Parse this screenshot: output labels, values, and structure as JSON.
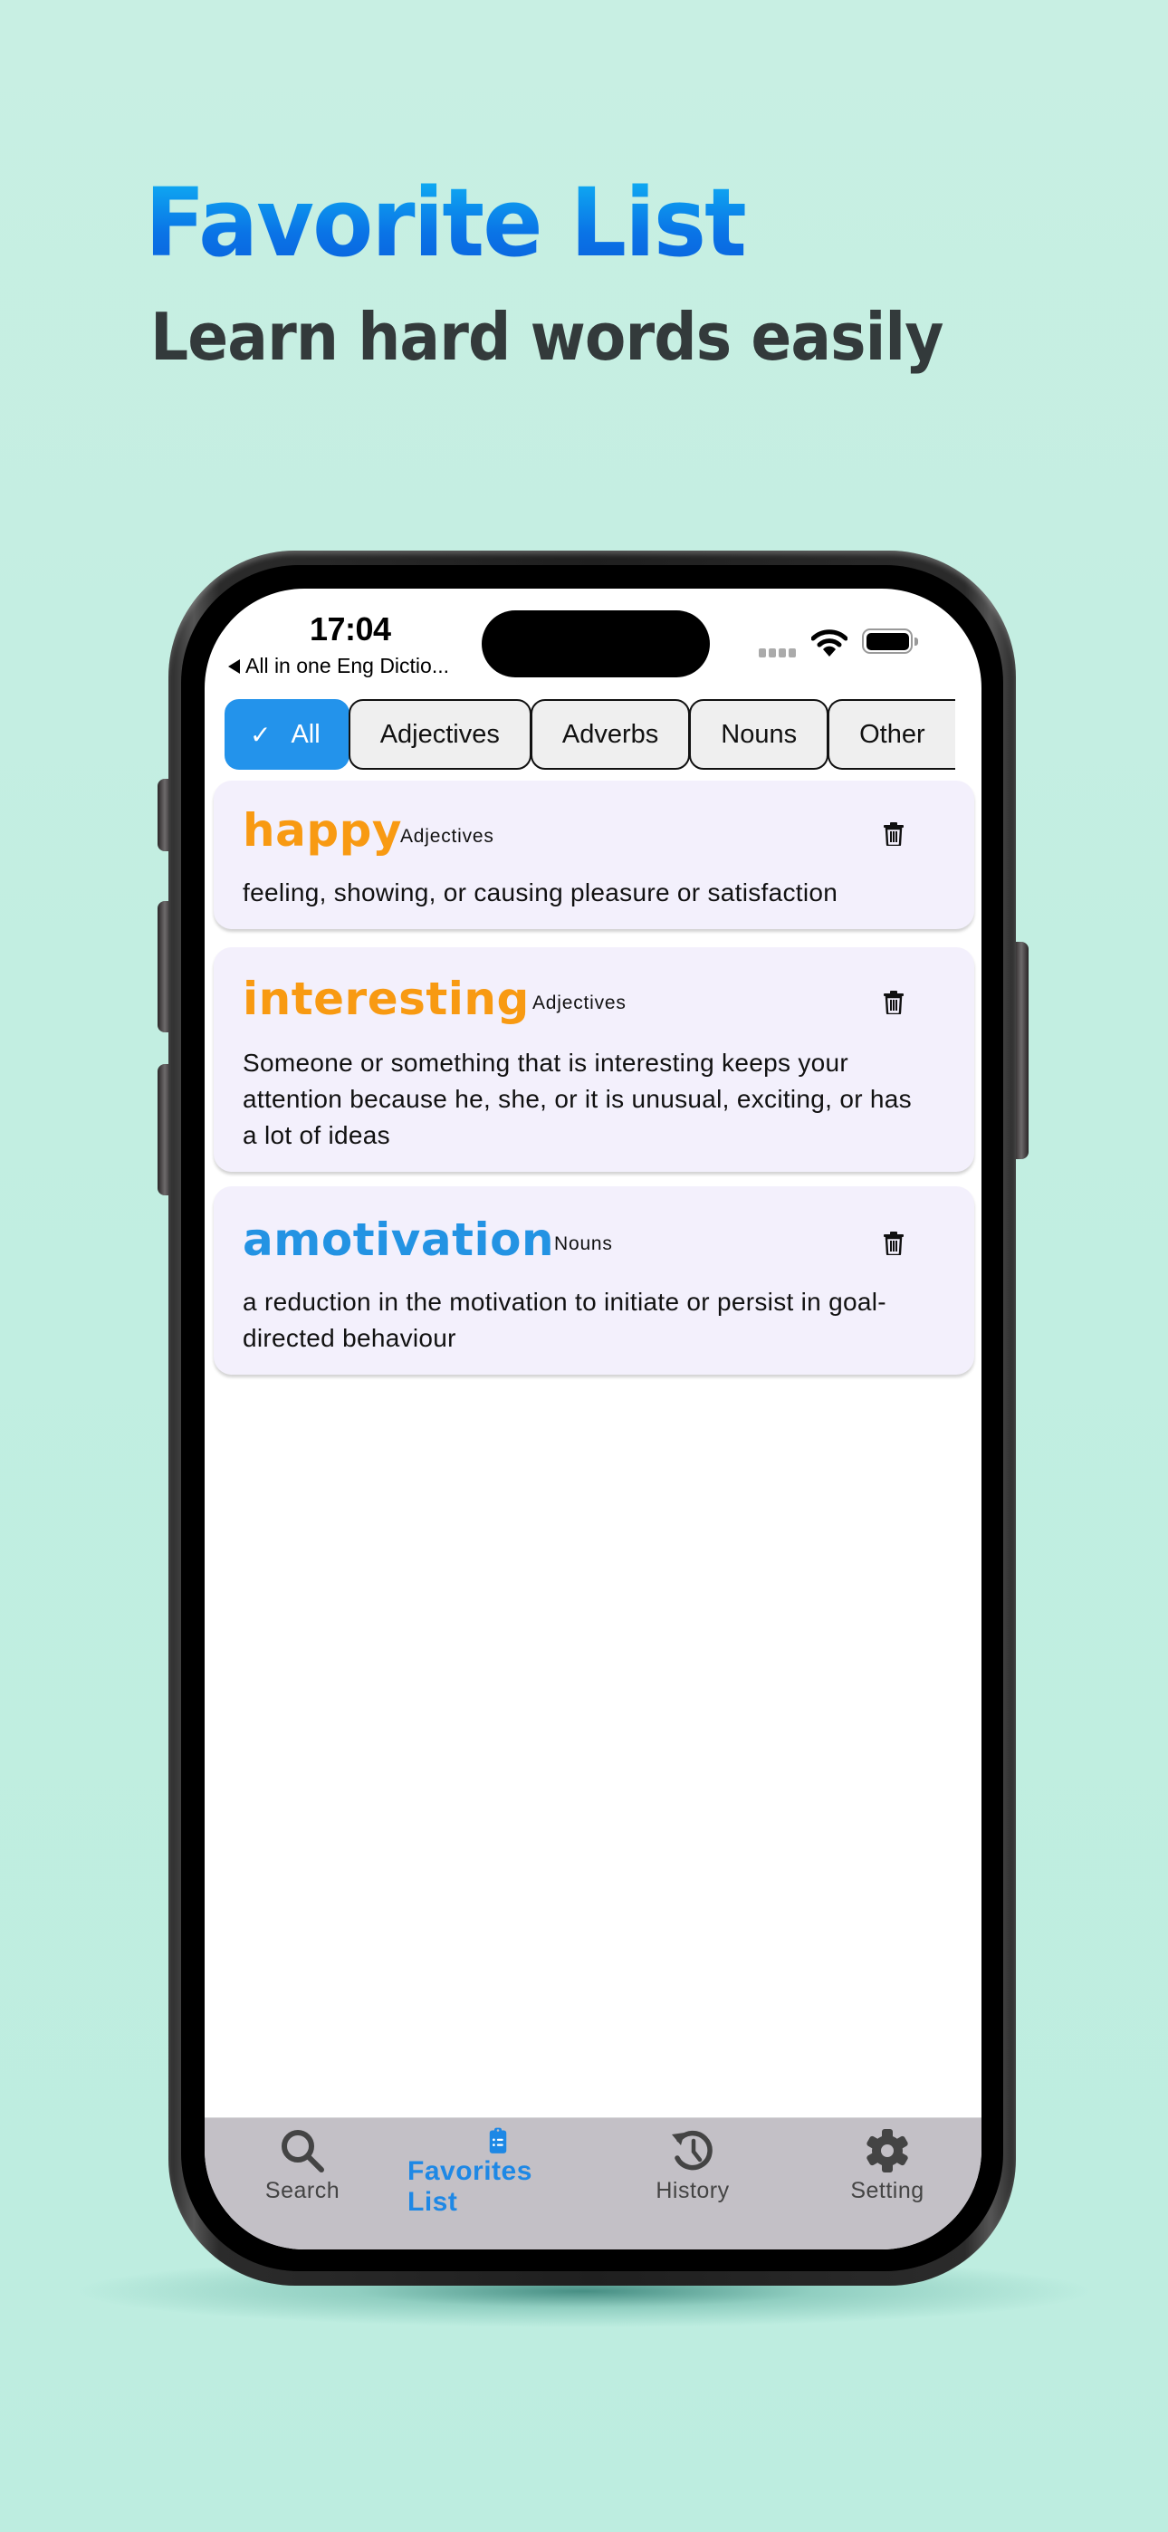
{
  "promo": {
    "title": "Favorite List",
    "subtitle": "Learn hard words easily"
  },
  "status_bar": {
    "time": "17:04",
    "back_app": "All in one Eng Dictio..."
  },
  "filters": {
    "items": [
      {
        "label": "All",
        "selected": true
      },
      {
        "label": "Adjectives",
        "selected": false
      },
      {
        "label": "Adverbs",
        "selected": false
      },
      {
        "label": "Nouns",
        "selected": false
      },
      {
        "label": "Other",
        "selected": false
      }
    ]
  },
  "favorites": [
    {
      "word": "happy",
      "part_of_speech": "Adjectives",
      "definition": "feeling, showing, or causing pleasure or satisfaction",
      "color": "#f89a12"
    },
    {
      "word": "interesting",
      "part_of_speech": "Adjectives",
      "definition": "Someone or something that is interesting keeps your attention because he, she, or it is unusual, exciting, or has a lot of ideas",
      "color": "#f89a12"
    },
    {
      "word": "amotivation",
      "part_of_speech": "Nouns",
      "definition": "a reduction in the motivation to initiate or persist in goal-directed behaviour",
      "color": "#2393e3"
    }
  ],
  "tab_bar": {
    "items": [
      {
        "label": "Search",
        "icon": "search-icon",
        "active": false
      },
      {
        "label": "Favorites List",
        "icon": "clipboard-list-icon",
        "active": true
      },
      {
        "label": "History",
        "icon": "history-icon",
        "active": false
      },
      {
        "label": "Setting",
        "icon": "gear-icon",
        "active": false
      }
    ]
  },
  "colors": {
    "accent": "#2393eb",
    "adjective_word": "#f89a12",
    "noun_word": "#2393e3",
    "card_bg": "#f3f0fc",
    "tabbar_bg": "#c3c0c6",
    "background": "#c2eee1"
  }
}
